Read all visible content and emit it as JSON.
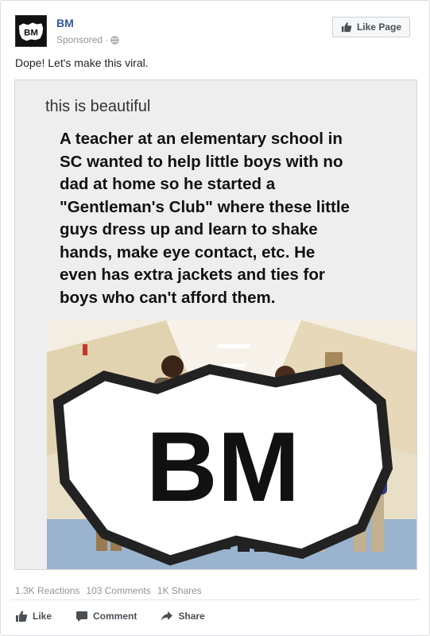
{
  "post": {
    "page_name": "BM",
    "sponsored_label": "Sponsored ·",
    "like_page_label": "Like Page",
    "text": "Dope! Let's make this viral.",
    "avatar_logo_text": "BM"
  },
  "shared_image": {
    "caption": "this is beautiful",
    "body_lines": [
      "A teacher at an elementary school in",
      "SC wanted to help little boys with no",
      "dad at home so he started a",
      "\"Gentleman's Club\" where these little",
      "guys dress up and learn to shake",
      "hands, make eye contact, etc.  He",
      "even has extra jackets and ties for",
      "boys who can't afford them."
    ],
    "watermark_text": "BM"
  },
  "stats": {
    "reactions": "1.3K Reactions",
    "comments": "103 Comments",
    "shares": "1K Shares"
  },
  "actions": {
    "like": "Like",
    "comment": "Comment",
    "share": "Share"
  },
  "icons": {
    "globe": "globe-icon",
    "thumbs_up": "thumbs-up-icon",
    "comment": "comment-icon",
    "share": "share-arrow-icon"
  },
  "colors": {
    "link_blue": "#365899",
    "meta_gray": "#90949c",
    "action_gray": "#4b4f56"
  }
}
